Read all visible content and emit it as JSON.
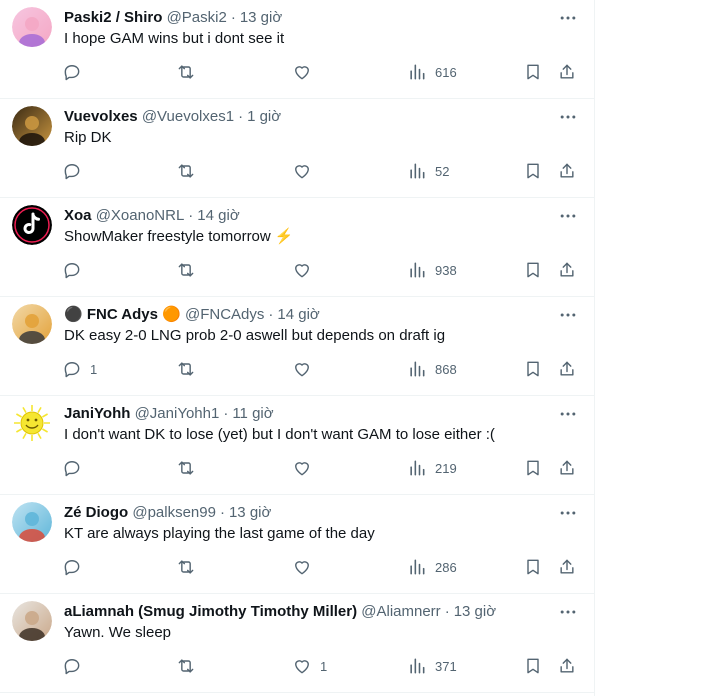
{
  "tweets": [
    {
      "name": "Paski2 / Shiro",
      "handle": "@Paski2",
      "time": "13 giờ",
      "text": "I hope GAM wins but i dont see it",
      "replies": "",
      "retweets": "",
      "likes": "",
      "views": "616",
      "avatar_colors": [
        "#f7c6e0",
        "#f4a7c4",
        "#a66bd6"
      ]
    },
    {
      "name": "Vuevolxes",
      "handle": "@Vuevolxes1",
      "time": "1 giờ",
      "text": "Rip DK",
      "replies": "",
      "retweets": "",
      "likes": "",
      "views": "52",
      "avatar_colors": [
        "#3a2a14",
        "#c99640",
        "#1a120a"
      ]
    },
    {
      "name": "Xoa",
      "handle": "@XoanoNRL",
      "time": "14 giờ",
      "text": "ShowMaker freestyle tomorrow ⚡",
      "replies": "",
      "retweets": "",
      "likes": "",
      "views": "938",
      "avatar_colors": [
        "#000000",
        "#ffffff",
        "#ee1d52"
      ]
    },
    {
      "name": "⚫ FNC Adys 🟠",
      "handle": "@FNCAdys",
      "time": "14 giờ",
      "text": "DK easy 2-0 LNG prob 2-0 aswell but depends on draft ig",
      "replies": "1",
      "retweets": "",
      "likes": "",
      "views": "868",
      "avatar_colors": [
        "#f2d9a8",
        "#e3a23a",
        "#3b3b3b"
      ]
    },
    {
      "name": "JaniYohh",
      "handle": "@JaniYohh1",
      "time": "11 giờ",
      "text": "I don't want DK to lose (yet) but I don't want GAM  to lose either :(",
      "replies": "",
      "retweets": "",
      "likes": "",
      "views": "219",
      "avatar_colors": [
        "#ffffff",
        "#f5e631",
        "#6b5a00"
      ]
    },
    {
      "name": "Zé Diogo",
      "handle": "@palksen99",
      "time": "13 giờ",
      "text": "KT are always playing the last game of the day",
      "replies": "",
      "retweets": "",
      "likes": "",
      "views": "286",
      "avatar_colors": [
        "#bfe3f2",
        "#5fb6d9",
        "#d94a3a"
      ]
    },
    {
      "name": "aLiamnah (Smug Jimothy Timothy Miller)",
      "handle": "@Aliamnerr",
      "time": "13 giờ",
      "text": "Yawn. We sleep",
      "replies": "",
      "retweets": "",
      "likes": "1",
      "views": "371",
      "avatar_colors": [
        "#e9e6e1",
        "#caa88a",
        "#3d3026"
      ]
    }
  ],
  "colors": {
    "text_primary": "#0f1419",
    "text_secondary": "#536471",
    "divider": "#eff3f4"
  },
  "icons": {
    "more": "more-dots-icon",
    "reply": "reply-icon",
    "retweet": "retweet-icon",
    "like": "heart-icon",
    "views": "views-icon",
    "bookmark": "bookmark-icon",
    "share": "share-icon"
  }
}
